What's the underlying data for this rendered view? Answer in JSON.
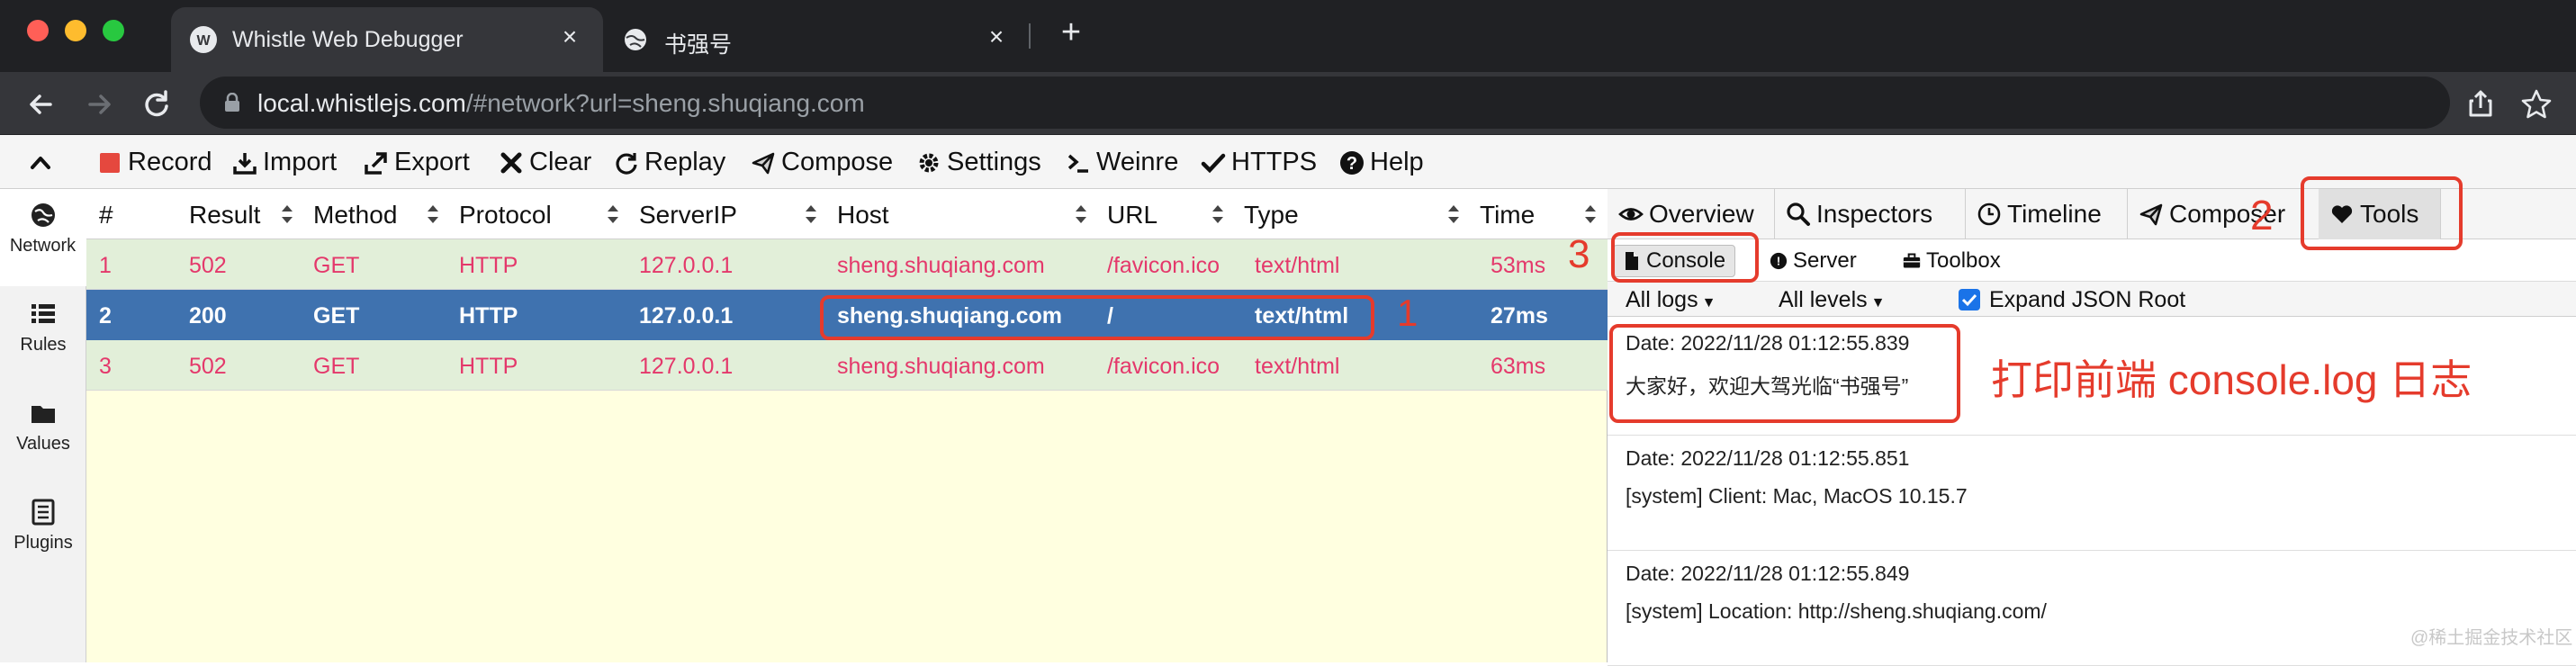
{
  "browser": {
    "tabs": [
      {
        "title": "Whistle Web Debugger",
        "active": true
      },
      {
        "title": "书强号",
        "active": false
      }
    ],
    "url_host": "local.whistlejs.com",
    "url_path": "/#network?url=sheng.shuqiang.com"
  },
  "menu": {
    "items": [
      "Record",
      "Import",
      "Export",
      "Clear",
      "Replay",
      "Compose",
      "Settings",
      "Weinre",
      "HTTPS",
      "Help"
    ]
  },
  "sidebar": {
    "items": [
      "Network",
      "Rules",
      "Values",
      "Plugins"
    ]
  },
  "network": {
    "columns": [
      "#",
      "Result",
      "Method",
      "Protocol",
      "ServerIP",
      "Host",
      "URL",
      "Type",
      "Time"
    ],
    "rows": [
      {
        "num": "1",
        "result": "502",
        "method": "GET",
        "protocol": "HTTP",
        "ip": "127.0.0.1",
        "host": "sheng.shuqiang.com",
        "url": "/favicon.ico",
        "type": "text/html",
        "time": "53ms"
      },
      {
        "num": "2",
        "result": "200",
        "method": "GET",
        "protocol": "HTTP",
        "ip": "127.0.0.1",
        "host": "sheng.shuqiang.com",
        "url": "/",
        "type": "text/html",
        "time": "27ms"
      },
      {
        "num": "3",
        "result": "502",
        "method": "GET",
        "protocol": "HTTP",
        "ip": "127.0.0.1",
        "host": "sheng.shuqiang.com",
        "url": "/favicon.ico",
        "type": "text/html",
        "time": "63ms"
      }
    ]
  },
  "detail": {
    "tabs": [
      "Overview",
      "Inspectors",
      "Timeline",
      "Composer",
      "Tools"
    ],
    "subtabs": [
      "Console",
      "Server",
      "Toolbox"
    ],
    "filters": {
      "logs": "All logs",
      "levels": "All levels",
      "expand": "Expand JSON Root"
    },
    "logs": [
      {
        "date": "Date: 2022/11/28 01:12:55.839",
        "message": "大家好，欢迎大驾光临“书强号”"
      },
      {
        "date": "Date: 2022/11/28 01:12:55.851",
        "message": "[system]   Client:   Mac, MacOS 10.15.7"
      },
      {
        "date": "Date: 2022/11/28 01:12:55.849",
        "message": "[system]   Location:   http://sheng.shuqiang.com/"
      }
    ]
  },
  "annotations": {
    "n1": "1",
    "n2": "2",
    "n3": "3",
    "caption": "打印前端 console.log 日志"
  },
  "watermark": "@稀土掘金技术社区",
  "colors": {
    "selected_row": "#3f72af",
    "error_row": "#e2efd9",
    "error_text": "#e4386b",
    "annotation": "#e53b2c",
    "list_bg": "#ffffe0"
  }
}
